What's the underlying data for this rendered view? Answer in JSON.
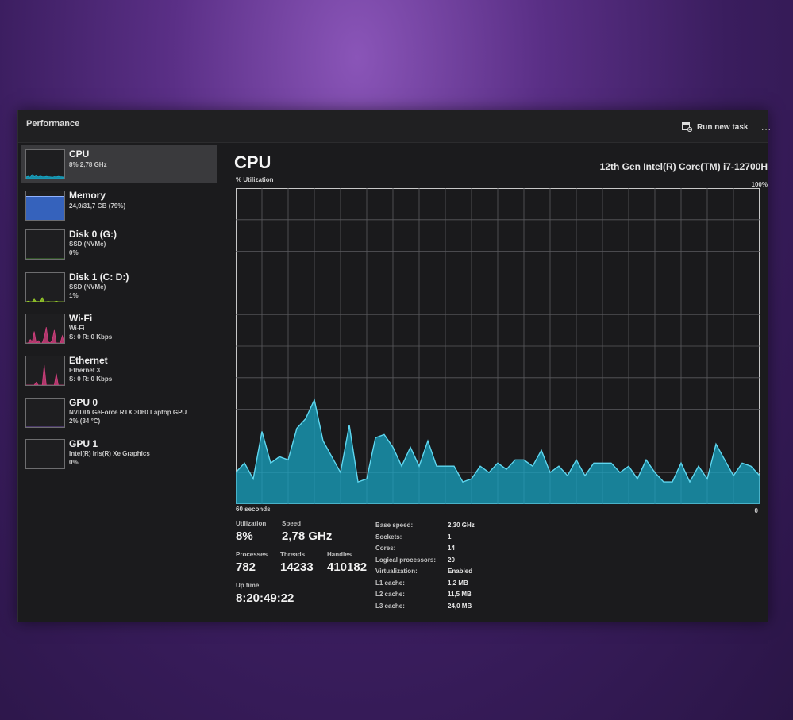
{
  "window": {
    "title": "Performance",
    "run_new_task": "Run new task",
    "more": "..."
  },
  "sidebar": {
    "items": [
      {
        "name": "CPU",
        "lines": [
          "8% 2,78 GHz"
        ],
        "color": "#17a9c9",
        "selected": true
      },
      {
        "name": "Memory",
        "lines": [
          "24,9/31,7 GB (79%)"
        ],
        "color": "#3a6fd8",
        "selected": false
      },
      {
        "name": "Disk 0 (G:)",
        "lines": [
          "SSD (NVMe)",
          "0%"
        ],
        "color": "#4ea832",
        "selected": false
      },
      {
        "name": "Disk 1 (C: D:)",
        "lines": [
          "SSD (NVMe)",
          "1%"
        ],
        "color": "#9ad02a",
        "selected": false
      },
      {
        "name": "Wi-Fi",
        "lines": [
          "Wi-Fi",
          "S: 0 R: 0 Kbps"
        ],
        "color": "#d23f7e",
        "selected": false
      },
      {
        "name": "Ethernet",
        "lines": [
          "Ethernet 3",
          "S: 0 R: 0 Kbps"
        ],
        "color": "#d23f7e",
        "selected": false
      },
      {
        "name": "GPU 0",
        "lines": [
          "NVIDIA GeForce RTX 3060 Laptop GPU",
          "2% (34 °C)"
        ],
        "color": "#8a5cd6",
        "selected": false
      },
      {
        "name": "GPU 1",
        "lines": [
          "Intel(R) Iris(R) Xe Graphics",
          "0%"
        ],
        "color": "#8a5cd6",
        "selected": false
      }
    ]
  },
  "main": {
    "title": "CPU",
    "processor": "12th Gen Intel(R) Core(TM) i7-12700H",
    "util_label": "% Utilization",
    "max_label": "100%",
    "time_label": "60 seconds",
    "zero_label": "0",
    "accent": "#17a9c9"
  },
  "chart_data": {
    "type": "area",
    "x": [
      60,
      59,
      58,
      57,
      56,
      55,
      54,
      53,
      52,
      51,
      50,
      49,
      48,
      47,
      46,
      45,
      44,
      43,
      42,
      41,
      40,
      39,
      38,
      37,
      36,
      35,
      34,
      33,
      32,
      31,
      30,
      29,
      28,
      27,
      26,
      25,
      24,
      23,
      22,
      21,
      20,
      19,
      18,
      17,
      16,
      15,
      14,
      13,
      12,
      11,
      10,
      9,
      8,
      7,
      6,
      5,
      4,
      3,
      2,
      1,
      0
    ],
    "values": [
      10,
      13,
      8,
      23,
      13,
      15,
      14,
      24,
      27,
      33,
      20,
      15,
      10,
      25,
      7,
      8,
      21,
      22,
      18,
      12,
      18,
      12,
      20,
      12,
      12,
      12,
      7,
      8,
      12,
      10,
      13,
      11,
      14,
      14,
      12,
      17,
      10,
      12,
      9,
      14,
      9,
      13,
      13,
      13,
      10,
      12,
      8,
      14,
      10,
      7,
      7,
      13,
      7,
      12,
      8,
      19,
      14,
      9,
      13,
      12,
      9
    ],
    "xlabel": "60 seconds",
    "ylabel": "% Utilization",
    "ylim": [
      0,
      100
    ],
    "grid": true
  },
  "stats": {
    "utilization": {
      "label": "Utilization",
      "value": "8%"
    },
    "speed": {
      "label": "Speed",
      "value": "2,78 GHz"
    },
    "processes": {
      "label": "Processes",
      "value": "782"
    },
    "threads": {
      "label": "Threads",
      "value": "14233"
    },
    "handles": {
      "label": "Handles",
      "value": "410182"
    },
    "uptime": {
      "label": "Up time",
      "value": "8:20:49:22"
    }
  },
  "specs": [
    {
      "key": "Base speed:",
      "value": "2,30 GHz"
    },
    {
      "key": "Sockets:",
      "value": "1"
    },
    {
      "key": "Cores:",
      "value": "14"
    },
    {
      "key": "Logical processors:",
      "value": "20"
    },
    {
      "key": "Virtualization:",
      "value": "Enabled"
    },
    {
      "key": "L1 cache:",
      "value": "1,2 MB"
    },
    {
      "key": "L2 cache:",
      "value": "11,5 MB"
    },
    {
      "key": "L3 cache:",
      "value": "24,0 MB"
    }
  ]
}
